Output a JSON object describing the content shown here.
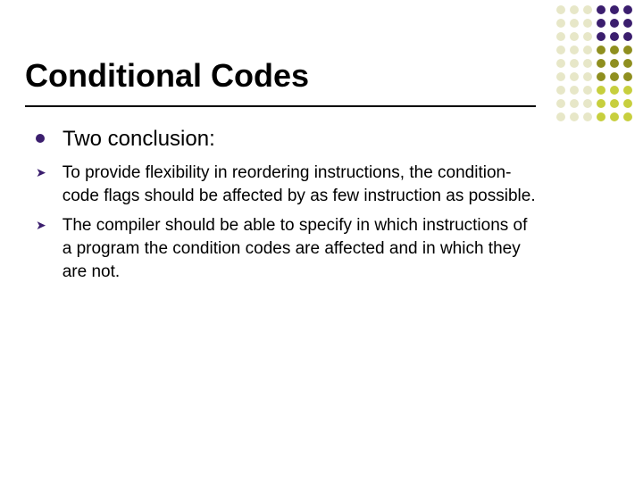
{
  "title": "Conditional Codes",
  "bullets": [
    {
      "text": "Two conclusion:"
    }
  ],
  "subbullets": [
    "To provide flexibility in reordering instructions, the condition-code flags should be affected by as few instruction as possible.",
    "The compiler should be able to specify in which instructions of a program the condition codes are affected and in which they are not."
  ],
  "colors": {
    "accent_purple": "#3b1e6e",
    "accent_lime": "#c7cf3e",
    "accent_olive": "#8f8f1f",
    "deco_light": "#e7e7c8"
  },
  "deco_grid": {
    "cols": 6,
    "rows": 9,
    "pattern": [
      [
        "L",
        "L",
        "L",
        "P",
        "P",
        "P"
      ],
      [
        "L",
        "L",
        "L",
        "P",
        "P",
        "P"
      ],
      [
        "L",
        "L",
        "L",
        "P",
        "P",
        "P"
      ],
      [
        "L",
        "L",
        "L",
        "O",
        "O",
        "O"
      ],
      [
        "L",
        "L",
        "L",
        "O",
        "O",
        "O"
      ],
      [
        "L",
        "L",
        "L",
        "O",
        "O",
        "O"
      ],
      [
        "L",
        "L",
        "L",
        "G",
        "G",
        "G"
      ],
      [
        "L",
        "L",
        "L",
        "G",
        "G",
        "G"
      ],
      [
        "L",
        "L",
        "L",
        "G",
        "G",
        "G"
      ]
    ],
    "legend": {
      "L": "deco_light",
      "P": "accent_purple",
      "O": "accent_olive",
      "G": "accent_lime"
    }
  }
}
